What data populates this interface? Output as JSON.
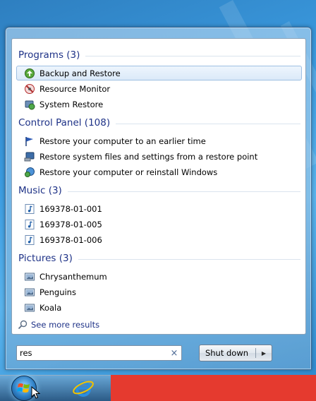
{
  "groups": [
    {
      "title": "Programs (3)"
    },
    {
      "title": "Control Panel (108)"
    },
    {
      "title": "Music (3)"
    },
    {
      "title": "Pictures (3)"
    }
  ],
  "programs": [
    {
      "label": "Backup and Restore",
      "icon": "backup-restore-icon",
      "selected": true
    },
    {
      "label": "Resource Monitor",
      "icon": "resource-monitor-icon"
    },
    {
      "label": "System Restore",
      "icon": "system-restore-icon"
    }
  ],
  "control_panel": [
    {
      "label": "Restore your computer to an earlier time",
      "icon": "flag-icon"
    },
    {
      "label": "Restore system files and settings from a restore point",
      "icon": "restore-point-icon"
    },
    {
      "label": "Restore your computer or reinstall Windows",
      "icon": "reinstall-icon"
    }
  ],
  "music": [
    {
      "label": "169378-01-001",
      "icon": "music-file-icon"
    },
    {
      "label": "169378-01-005",
      "icon": "music-file-icon"
    },
    {
      "label": "169378-01-006",
      "icon": "music-file-icon"
    }
  ],
  "pictures": [
    {
      "label": "Chrysanthemum",
      "icon": "picture-file-icon"
    },
    {
      "label": "Penguins",
      "icon": "picture-file-icon"
    },
    {
      "label": "Koala",
      "icon": "picture-file-icon"
    }
  ],
  "see_more": {
    "label": "See more results"
  },
  "search": {
    "value": "res",
    "clear": "×"
  },
  "shutdown": {
    "label": "Shut down",
    "arrow": "▶"
  },
  "colors": {
    "group_title": "#1e3287",
    "taskbar_app": "#e53a2f"
  }
}
